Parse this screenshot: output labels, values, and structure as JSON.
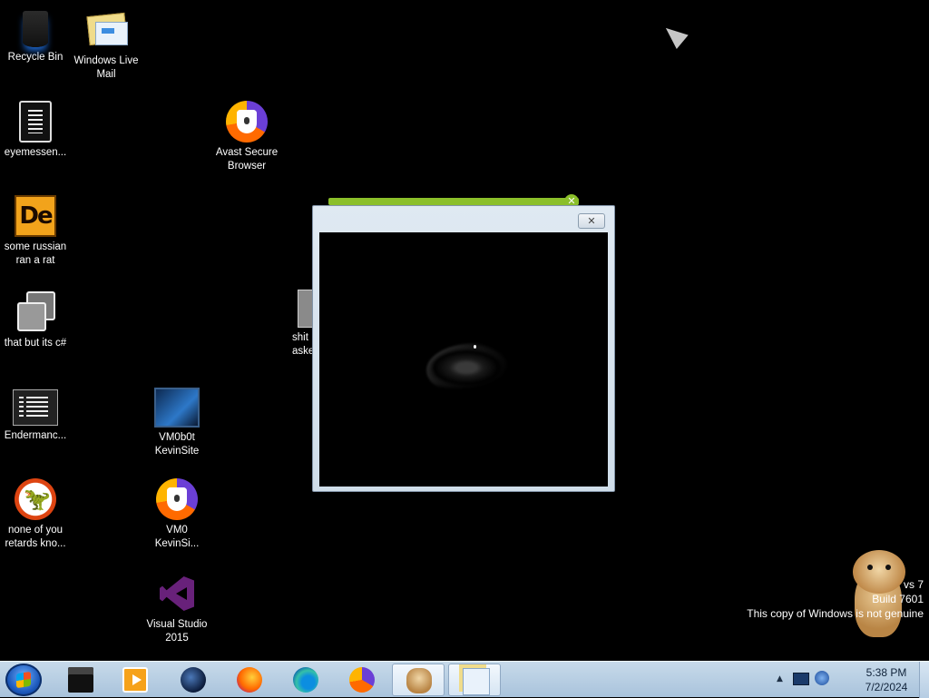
{
  "desktop": {
    "icons": [
      {
        "label": "Recycle Bin",
        "icon": "recycle-bin-icon"
      },
      {
        "label": "Windows Live\nMail",
        "icon": "mail-icon"
      },
      {
        "label": "eyemessen...",
        "icon": "document-icon"
      },
      {
        "label": "Avast Secure\nBrowser",
        "icon": "avast-browser-icon"
      },
      {
        "label": "some russian\nran a rat",
        "icon": "de-app-icon"
      },
      {
        "label": "that but its c#",
        "icon": "copy-icon"
      },
      {
        "label": "shit\naske",
        "icon": "folder-icon"
      },
      {
        "label": "Endermanc...",
        "icon": "list-app-icon"
      },
      {
        "label": "VM0b0t\nKevinSite",
        "icon": "vm-icon"
      },
      {
        "label": "none of you\nretards kno...",
        "icon": "dino-icon"
      },
      {
        "label": "VM0\nKevinSi...",
        "icon": "avast-browser-icon"
      },
      {
        "label": "Visual Studio\n2015",
        "icon": "visual-studio-icon"
      }
    ]
  },
  "window": {
    "close_glyph": "✕",
    "behind_close_glyph": "✕"
  },
  "watermark": {
    "line1": "vs 7",
    "line2": "Build 7601",
    "line3": "This copy of Windows is not genuine"
  },
  "taskbar": {
    "buttons": [
      {
        "icon": "explorer-icon"
      },
      {
        "icon": "media-player-icon"
      },
      {
        "icon": "globe-app-icon"
      },
      {
        "icon": "firefox-icon"
      },
      {
        "icon": "edge-icon"
      },
      {
        "icon": "avast-browser-icon"
      },
      {
        "icon": "hamster-icon",
        "active": true
      },
      {
        "icon": "mail-icon",
        "active": true
      }
    ],
    "tray": {
      "arrow": "▲",
      "time": "5:38 PM",
      "date": "7/2/2024"
    }
  }
}
